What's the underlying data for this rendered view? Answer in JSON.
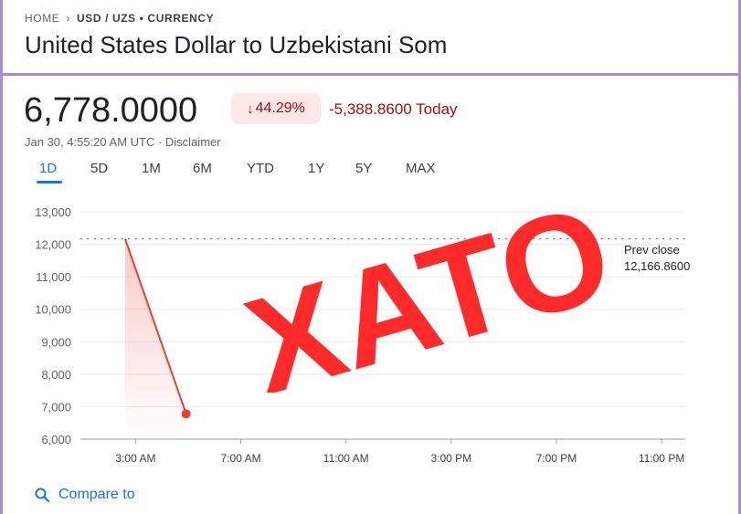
{
  "breadcrumb": {
    "home": "HOME",
    "current": "USD / UZS • CURRENCY"
  },
  "title": "United States Dollar to Uzbekistani Som",
  "quote": {
    "price": "6,778.0000",
    "change_percent": "44.29%",
    "change_value": "-5,388.8600 Today",
    "timestamp": "Jan 30, 4:55:20 AM UTC · Disclaimer"
  },
  "tabs": [
    "1D",
    "5D",
    "1M",
    "6M",
    "YTD",
    "1Y",
    "5Y",
    "MAX"
  ],
  "active_tab": "1D",
  "prev_close": {
    "label": "Prev close",
    "value": "12,166.8600"
  },
  "compare_label": "Compare to",
  "stamp_text": "XATO",
  "colors": {
    "negative": "#a50e0e",
    "line": "#e94235",
    "accent": "#1a73e8",
    "stamp": "#ff2a2a"
  },
  "chart_data": {
    "type": "line",
    "x_tick_labels": [
      "3:00 AM",
      "7:00 AM",
      "11:00 AM",
      "3:00 PM",
      "7:00 PM",
      "11:00 PM"
    ],
    "y_tick_labels": [
      "13,000",
      "12,000",
      "11,000",
      "10,000",
      "9,000",
      "8,000",
      "7,000",
      "6,000"
    ],
    "ylim": [
      6000,
      13000
    ],
    "xlim_hours": [
      0.9,
      23.9
    ],
    "reference_line": 12166.86,
    "series": [
      {
        "x_hours": [
          2.6,
          4.92
        ],
        "values": [
          12166.86,
          6778.0
        ]
      }
    ]
  }
}
